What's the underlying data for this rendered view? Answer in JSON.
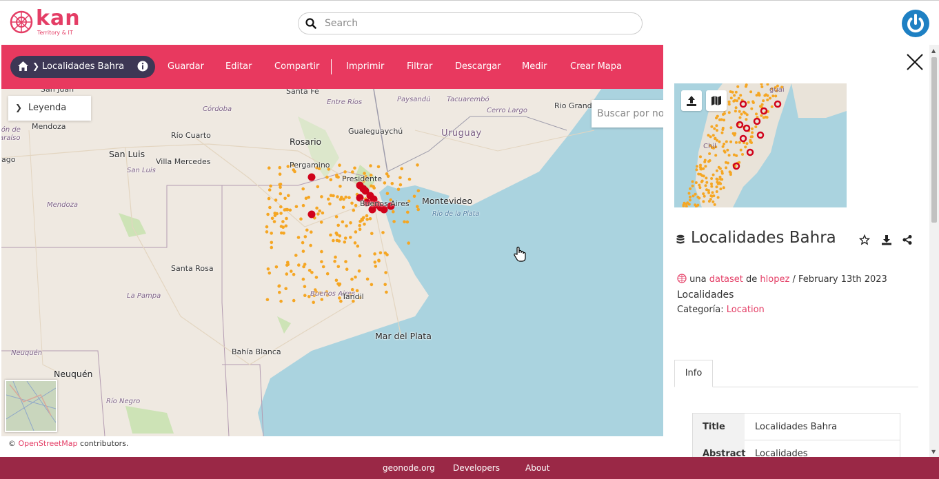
{
  "header": {
    "logo_text": "kan",
    "logo_sub": "Territory & IT",
    "search_placeholder": "Search"
  },
  "toolbar": {
    "breadcrumb_label": "Localidades Bahra",
    "items": [
      "Guardar",
      "Editar",
      "Compartir",
      "Imprimir",
      "Filtrar",
      "Descargar",
      "Medir",
      "Crear Mapa"
    ]
  },
  "map": {
    "legend_label": "Leyenda",
    "search_placeholder": "Buscar por no",
    "labels": [
      {
        "text": "San Juan",
        "cls": "city"
      },
      {
        "text": "Santa Fe",
        "cls": "city"
      },
      {
        "text": "Córdoba",
        "cls": "prov"
      },
      {
        "text": "Entre Ríos",
        "cls": "prov"
      },
      {
        "text": "Paysandú",
        "cls": "prov"
      },
      {
        "text": "Tacuarembó",
        "cls": "prov"
      },
      {
        "text": "Rio Grande",
        "cls": "city"
      },
      {
        "text": "Cerro Largo",
        "cls": "prov"
      },
      {
        "text": "Mendoza",
        "cls": "city"
      },
      {
        "text": "Río Cuarto",
        "cls": "city"
      },
      {
        "text": "Rosario",
        "cls": "citybig"
      },
      {
        "text": "Gualeguaychú",
        "cls": "city"
      },
      {
        "text": "Uruguay",
        "cls": "country"
      },
      {
        "text": "San Luis",
        "cls": "citybig"
      },
      {
        "text": "Villa Mercedes",
        "cls": "city"
      },
      {
        "text": "San Luis",
        "cls": "prov"
      },
      {
        "text": "Pergamino",
        "cls": "city"
      },
      {
        "text": "Presidente",
        "cls": "city"
      },
      {
        "text": "Mendoza",
        "cls": "prov"
      },
      {
        "text": "Buenos Aires",
        "cls": "city"
      },
      {
        "text": "Montevideo",
        "cls": "citybig"
      },
      {
        "text": "Río de la Plata",
        "cls": "water"
      },
      {
        "text": "Santa Rosa",
        "cls": "city"
      },
      {
        "text": "La Pampa",
        "cls": "prov"
      },
      {
        "text": "Buenos Aires",
        "cls": "prov"
      },
      {
        "text": "Tandil",
        "cls": "city"
      },
      {
        "text": "Mar del Plata",
        "cls": "citybig"
      },
      {
        "text": "Bahía Blanca",
        "cls": "city"
      },
      {
        "text": "Neuquén",
        "cls": "prov"
      },
      {
        "text": "Neuquén",
        "cls": "citybig"
      },
      {
        "text": "Río Negro",
        "cls": "prov"
      },
      {
        "text": "ión de",
        "cls": "prov"
      },
      {
        "text": "araíso",
        "cls": "prov"
      },
      {
        "text": "iago",
        "cls": "city"
      }
    ],
    "attribution_prefix": "©",
    "attribution_link": "OpenStreetMap",
    "attribution_suffix": "contributors."
  },
  "panel": {
    "title": "Localidades Bahra",
    "meta_prefix": "una",
    "meta_type": "dataset",
    "meta_de": "de",
    "meta_owner": "hlopez",
    "meta_date": "/ February 13th 2023",
    "description": "Localidades",
    "category_label": "Categoría:",
    "category_value": "Location",
    "thumb_label": "Chil",
    "thumb_label2": "guai",
    "tab_info": "Info",
    "table": [
      {
        "key": "Title",
        "value": "Localidades Bahra"
      },
      {
        "key": "Abstract",
        "value": "Localidades"
      }
    ]
  },
  "footer": {
    "links": [
      "geonode.org",
      "Developers",
      "About"
    ]
  },
  "colors": {
    "accent": "#e8395f",
    "footer": "#9a2846",
    "crumb": "#3d3755",
    "point_orange": "#f5a623",
    "point_red": "#d0021b",
    "water": "#aad3df",
    "power": "#1e80c3"
  }
}
